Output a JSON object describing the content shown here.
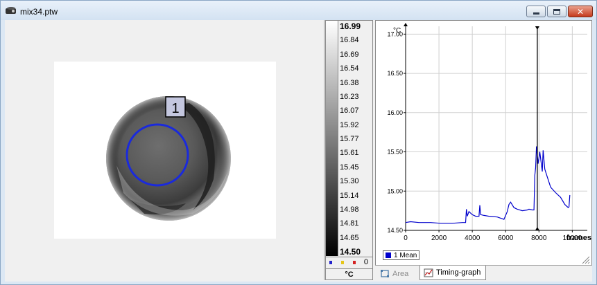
{
  "window": {
    "title": "mix34.ptw",
    "min_glyph": "minimize",
    "max_glyph": "maximize",
    "close_glyph": "✕"
  },
  "image": {
    "roi_label": "1"
  },
  "scale": {
    "labels": [
      "16.99",
      "16.84",
      "16.69",
      "16.54",
      "16.38",
      "16.23",
      "16.07",
      "15.92",
      "15.77",
      "15.61",
      "15.45",
      "15.30",
      "15.14",
      "14.98",
      "14.81",
      "14.65",
      "14.50"
    ],
    "footer_count": "0",
    "unit": "°C",
    "dot_colors": [
      "#2222cc",
      "#e6c619",
      "#d42222"
    ]
  },
  "chart_data": {
    "type": "line",
    "ylabel": "°C",
    "xlabel": "frames",
    "ylim": [
      14.5,
      17.1
    ],
    "xlim": [
      0,
      10900
    ],
    "yticks": [
      "17.00",
      "16.50",
      "16.00",
      "15.50",
      "15.00",
      "14.50"
    ],
    "ytick_values": [
      17.0,
      16.5,
      16.0,
      15.5,
      15.0,
      14.5
    ],
    "xticks": [
      "0",
      "2000",
      "4000",
      "6000",
      "8000",
      "10000"
    ],
    "xtick_values": [
      0,
      2000,
      4000,
      6000,
      8000,
      10000
    ],
    "cursor_x": 7900,
    "series": [
      {
        "name": "1 Mean",
        "color": "#0000cc",
        "x": [
          0,
          300,
          800,
          1500,
          2100,
          2800,
          3400,
          3600,
          3650,
          3700,
          3800,
          4000,
          4200,
          4400,
          4450,
          4500,
          4700,
          5000,
          5500,
          5900,
          6100,
          6200,
          6300,
          6500,
          6700,
          7000,
          7300,
          7400,
          7600,
          7700,
          7750,
          7800,
          7850,
          7950,
          8050,
          8200,
          8250,
          8350,
          8500,
          8700,
          9000,
          9300,
          9550,
          9750,
          9800,
          9850
        ],
        "y": [
          14.6,
          14.61,
          14.6,
          14.6,
          14.59,
          14.59,
          14.6,
          14.6,
          14.77,
          14.68,
          14.74,
          14.7,
          14.68,
          14.68,
          14.82,
          14.7,
          14.69,
          14.68,
          14.67,
          14.64,
          14.74,
          14.83,
          14.86,
          14.79,
          14.77,
          14.75,
          14.76,
          14.77,
          14.76,
          14.76,
          15.2,
          15.3,
          15.57,
          15.35,
          15.5,
          15.25,
          15.52,
          15.28,
          15.18,
          15.05,
          14.98,
          14.92,
          14.83,
          14.79,
          14.8,
          14.95
        ]
      }
    ]
  },
  "legend": {
    "label": "1 Mean"
  },
  "tabs": [
    {
      "label": "Area",
      "active": false
    },
    {
      "label": "Timing-graph",
      "active": true
    }
  ]
}
